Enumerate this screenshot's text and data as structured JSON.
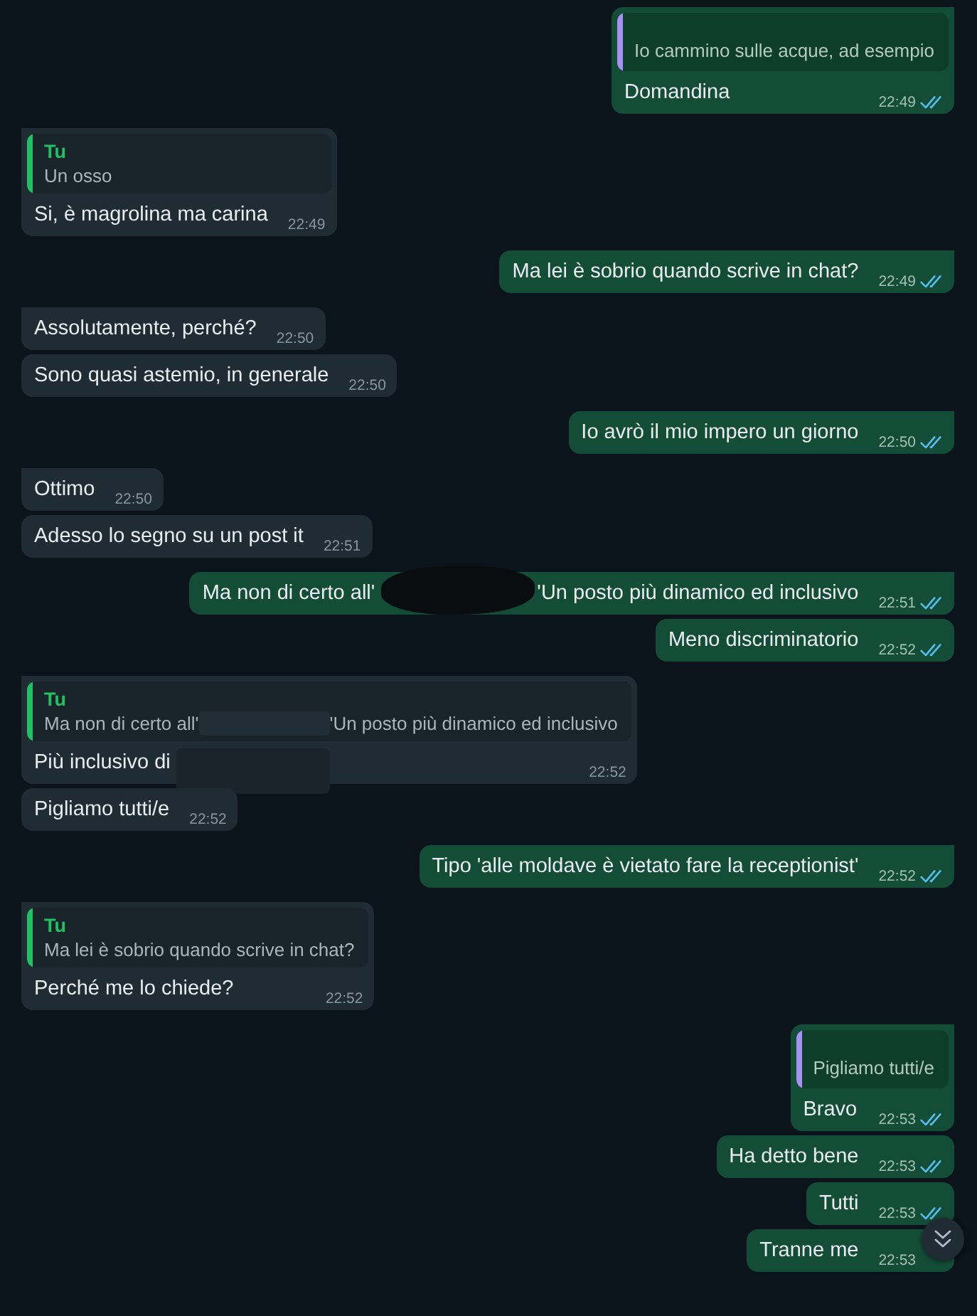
{
  "messages": [
    {
      "kind": "outgoing",
      "quote": {
        "text": "Io cammino sulle acque, ad esempio",
        "color": "#a791f2"
      },
      "text": "Domandina",
      "time": "22:49",
      "read": true
    },
    {
      "kind": "incoming",
      "quote": {
        "author": "Tu",
        "text": "Un osso",
        "color": "#21c063"
      },
      "text": "Si, è magrolina ma carina",
      "time": "22:49"
    },
    {
      "kind": "outgoing",
      "text": "Ma lei è sobrio quando scrive in chat?",
      "time": "22:49",
      "read": true
    },
    {
      "kind": "incoming",
      "text": "Assolutamente, perché?",
      "time": "22:50"
    },
    {
      "kind": "incoming",
      "text": "Sono quasi astemio, in generale",
      "time": "22:50"
    },
    {
      "kind": "outgoing",
      "text": "Io avrò il mio impero un giorno",
      "time": "22:50",
      "read": true
    },
    {
      "kind": "incoming",
      "text": "Ottimo",
      "time": "22:50"
    },
    {
      "kind": "incoming",
      "text": "Adesso lo segno su un post it",
      "time": "22:51"
    },
    {
      "kind": "outgoing",
      "text": "Ma non di certo all'",
      "redacted": true,
      "text_after": "'Un posto più dinamico ed inclusivo",
      "time": "22:51",
      "read": true
    },
    {
      "kind": "outgoing",
      "text": "Meno discriminatorio",
      "time": "22:52",
      "read": true
    },
    {
      "kind": "incoming",
      "quote": {
        "author": "Tu",
        "text": "Ma non di certo all'",
        "redacted": true,
        "text_after": "'Un posto più dinamico ed inclusivo",
        "color": "#21c063"
      },
      "text": "Più inclusivo di",
      "redacted": true,
      "time": "22:52"
    },
    {
      "kind": "incoming",
      "text": "Pigliamo tutti/e",
      "time": "22:52"
    },
    {
      "kind": "outgoing",
      "text": "Tipo 'alle moldave è vietato fare la receptionist'",
      "time": "22:52",
      "read": true
    },
    {
      "kind": "incoming",
      "quote": {
        "author": "Tu",
        "text": "Ma lei è sobrio quando scrive in chat?",
        "color": "#21c063"
      },
      "text": "Perché me lo chiede?",
      "time": "22:52"
    },
    {
      "kind": "outgoing",
      "quote": {
        "text": "Pigliamo tutti/e",
        "color": "#a791f2"
      },
      "text": "Bravo",
      "time": "22:53",
      "read": true
    },
    {
      "kind": "outgoing",
      "text": "Ha detto bene",
      "time": "22:53",
      "read": true
    },
    {
      "kind": "outgoing",
      "text": "Tutti",
      "time": "22:53",
      "read": true
    },
    {
      "kind": "outgoing",
      "text": "Tranne me",
      "time": "22:53"
    }
  ]
}
